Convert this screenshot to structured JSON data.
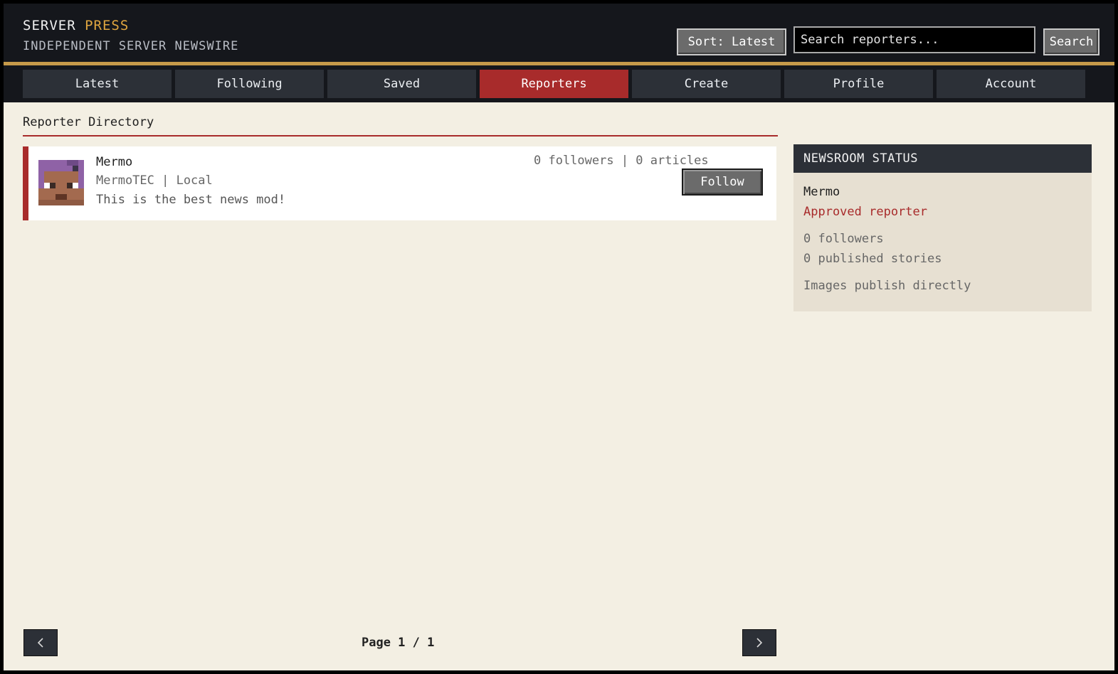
{
  "header": {
    "brand_main": "SERVER",
    "brand_accent": "PRESS",
    "tagline": "INDEPENDENT SERVER NEWSWIRE",
    "sort_label": "Sort: Latest",
    "search_value": "Search reporters...",
    "search_button": "Search"
  },
  "nav": {
    "tabs": [
      {
        "label": "Latest"
      },
      {
        "label": "Following"
      },
      {
        "label": "Saved"
      },
      {
        "label": "Reporters",
        "active": true
      },
      {
        "label": "Create"
      },
      {
        "label": "Profile"
      },
      {
        "label": "Account"
      }
    ]
  },
  "main": {
    "section_title": "Reporter Directory",
    "reporters": [
      {
        "name": "Mermo",
        "outlet": "MermoTEC | Local",
        "bio": "This is the best news mod!",
        "stats": "0 followers | 0 articles",
        "follow_label": "Follow"
      }
    ]
  },
  "sidebar": {
    "title": "NEWSROOM STATUS",
    "name": "Mermo",
    "status": "Approved reporter",
    "followers": "0 followers",
    "stories": "0 published stories",
    "images_note": "Images publish directly"
  },
  "pagination": {
    "label": "Page 1 / 1",
    "prev_icon": "chevron-left-icon",
    "next_icon": "chevron-right-icon"
  },
  "colors": {
    "accent_red": "#a82b2b",
    "accent_gold": "#c69a4a",
    "header_bg": "#15171c",
    "page_bg": "#f3efe3"
  }
}
